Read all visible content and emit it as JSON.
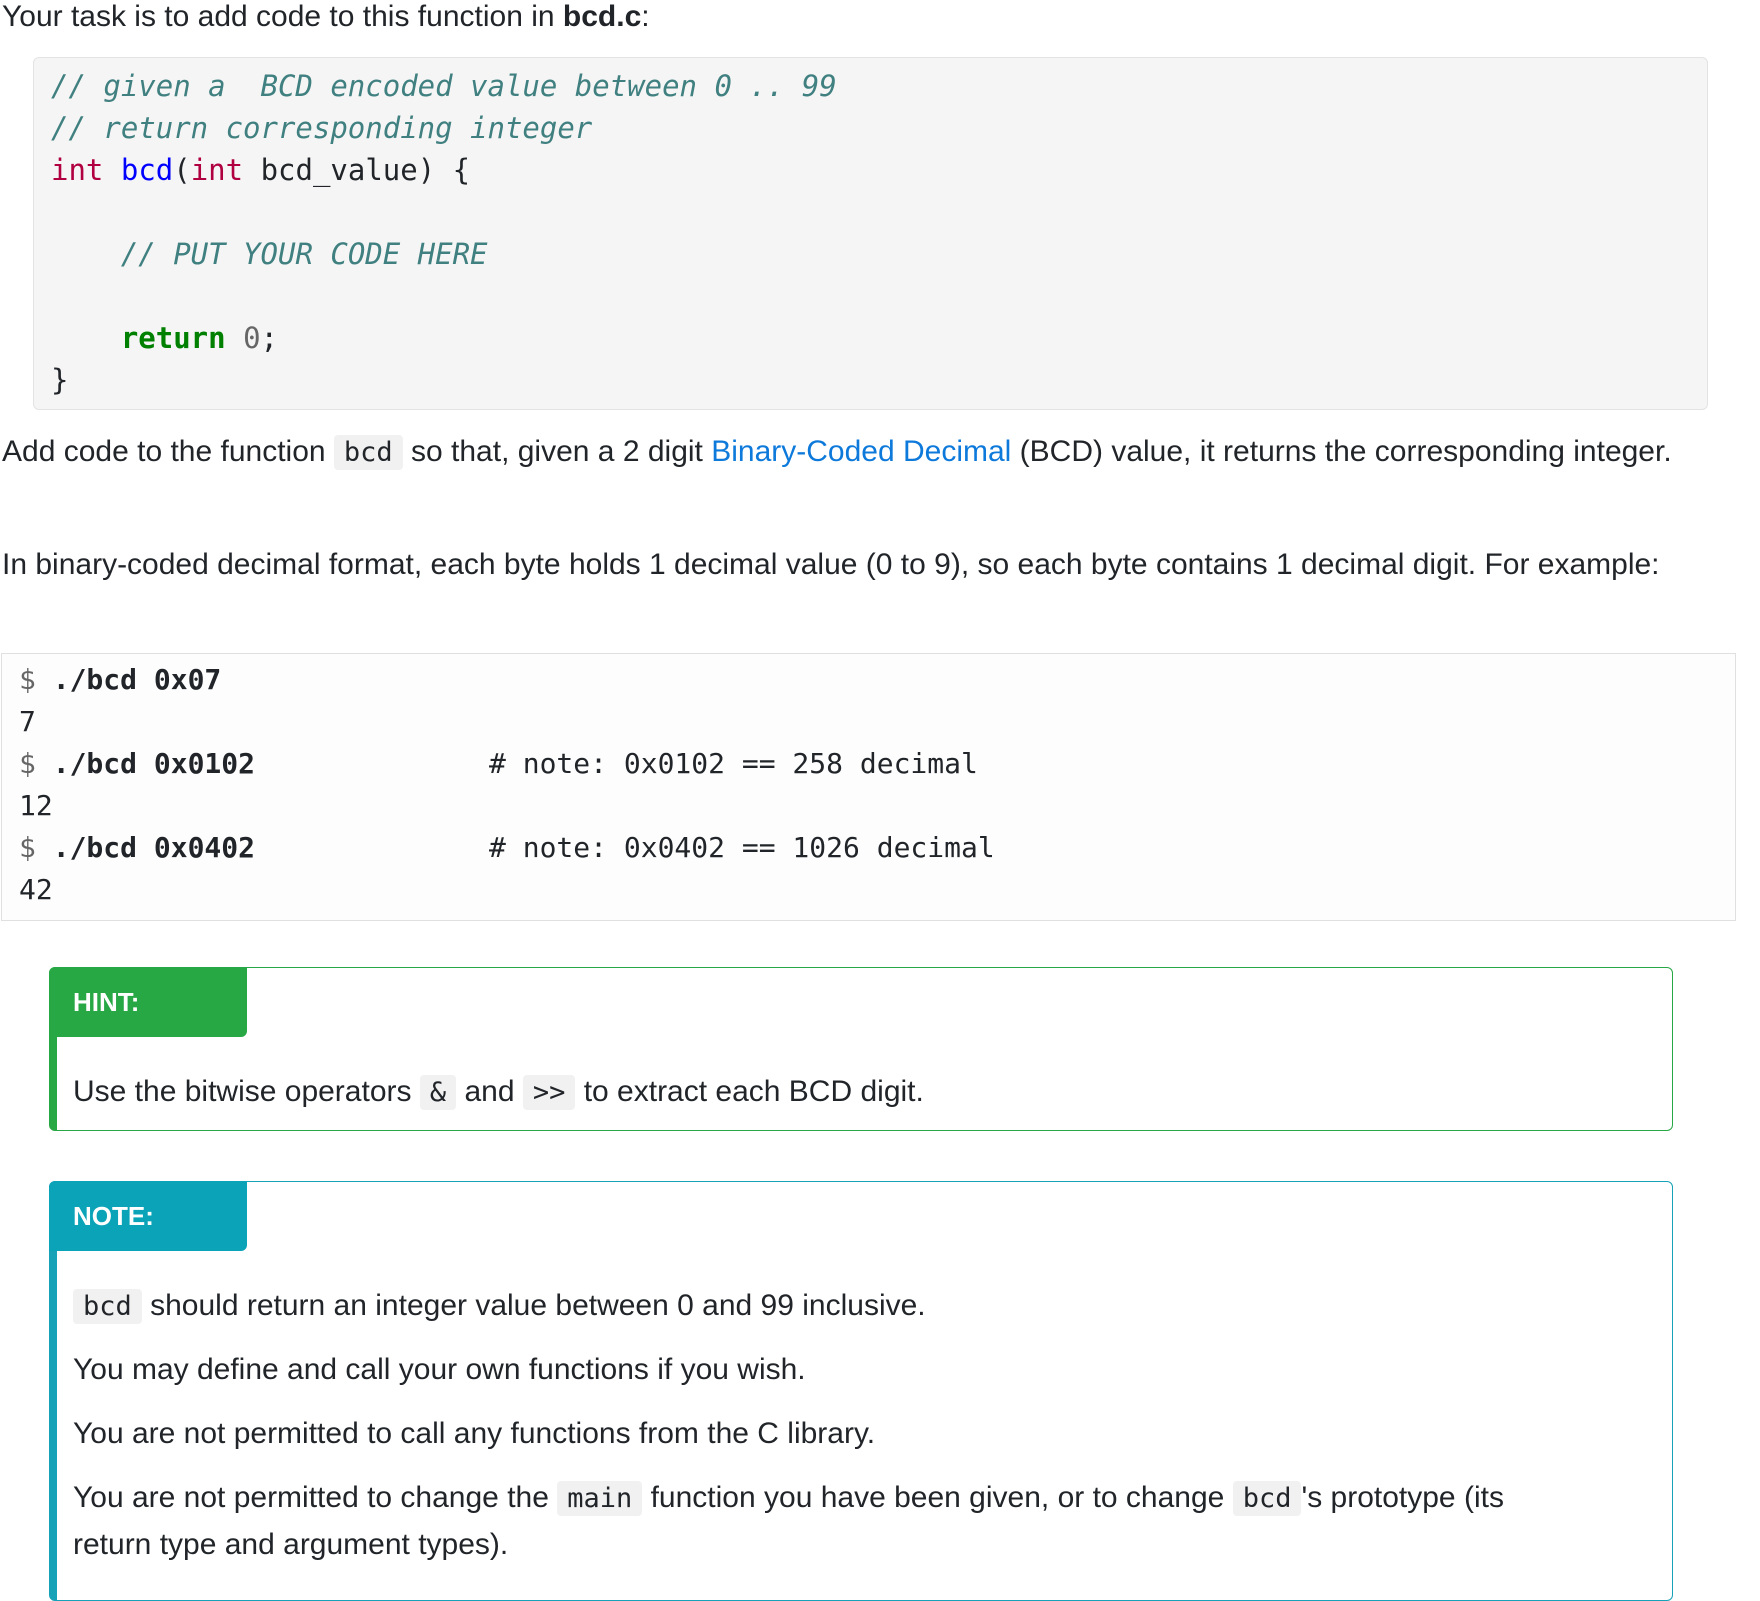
{
  "intro": {
    "prefix": "Your task is to add code to this function in ",
    "file": "bcd.c",
    "suffix": ":"
  },
  "code": {
    "l1": "// given a  BCD encoded value between 0 .. 99",
    "l2": "// return corresponding integer",
    "l3_kw1": "int",
    "l3_fn": "bcd",
    "l3_p1": "(",
    "l3_kw2": "int",
    "l3_rest": " bcd_value) {",
    "l4": "// PUT YOUR CODE HERE",
    "l5_kw": "return",
    "l5_num": "0",
    "l5_end": ";",
    "l6": "}"
  },
  "para1": {
    "a": "Add code to the function ",
    "code": "bcd",
    "b": " so that, given a 2 digit ",
    "link": "Binary-Coded Decimal",
    "c": " (BCD) value, it returns the corresponding integer."
  },
  "para2": "In binary-coded decimal format, each byte holds 1 decimal value (0 to 9), so each byte contains 1 decimal digit. For example:",
  "shell": {
    "prompt": "$",
    "cmd1": "./bcd 0x07",
    "out1": "7",
    "cmd2": "./bcd 0x0102",
    "note2": "# note: 0x0102 == 258 decimal",
    "out2": "12",
    "cmd3": "./bcd 0x0402",
    "note3": "# note: 0x0402 == 1026 decimal",
    "out3": "42"
  },
  "hint": {
    "title": "HINT:",
    "a": "Use the bitwise operators ",
    "op1": "&",
    "b": " and ",
    "op2": ">>",
    "c": " to extract each BCD digit."
  },
  "note": {
    "title": "NOTE:",
    "l1_code": "bcd",
    "l1_text": " should return an integer value between 0 and 99 inclusive.",
    "l2": "You may define and call your own functions if you wish.",
    "l3": "You are not permitted to call any functions from the C library.",
    "l4_a": "You are not permitted to change the ",
    "l4_code1": "main",
    "l4_b": " function you have been given, or to change ",
    "l4_code2": "bcd",
    "l4_c": "'s prototype (its",
    "l5": "return type and argument types)."
  },
  "colors": {
    "hint": "#28a745",
    "note": "#17a2b8",
    "link": "#0d7adb",
    "comment": "#408080",
    "keyword": "#b00040"
  }
}
